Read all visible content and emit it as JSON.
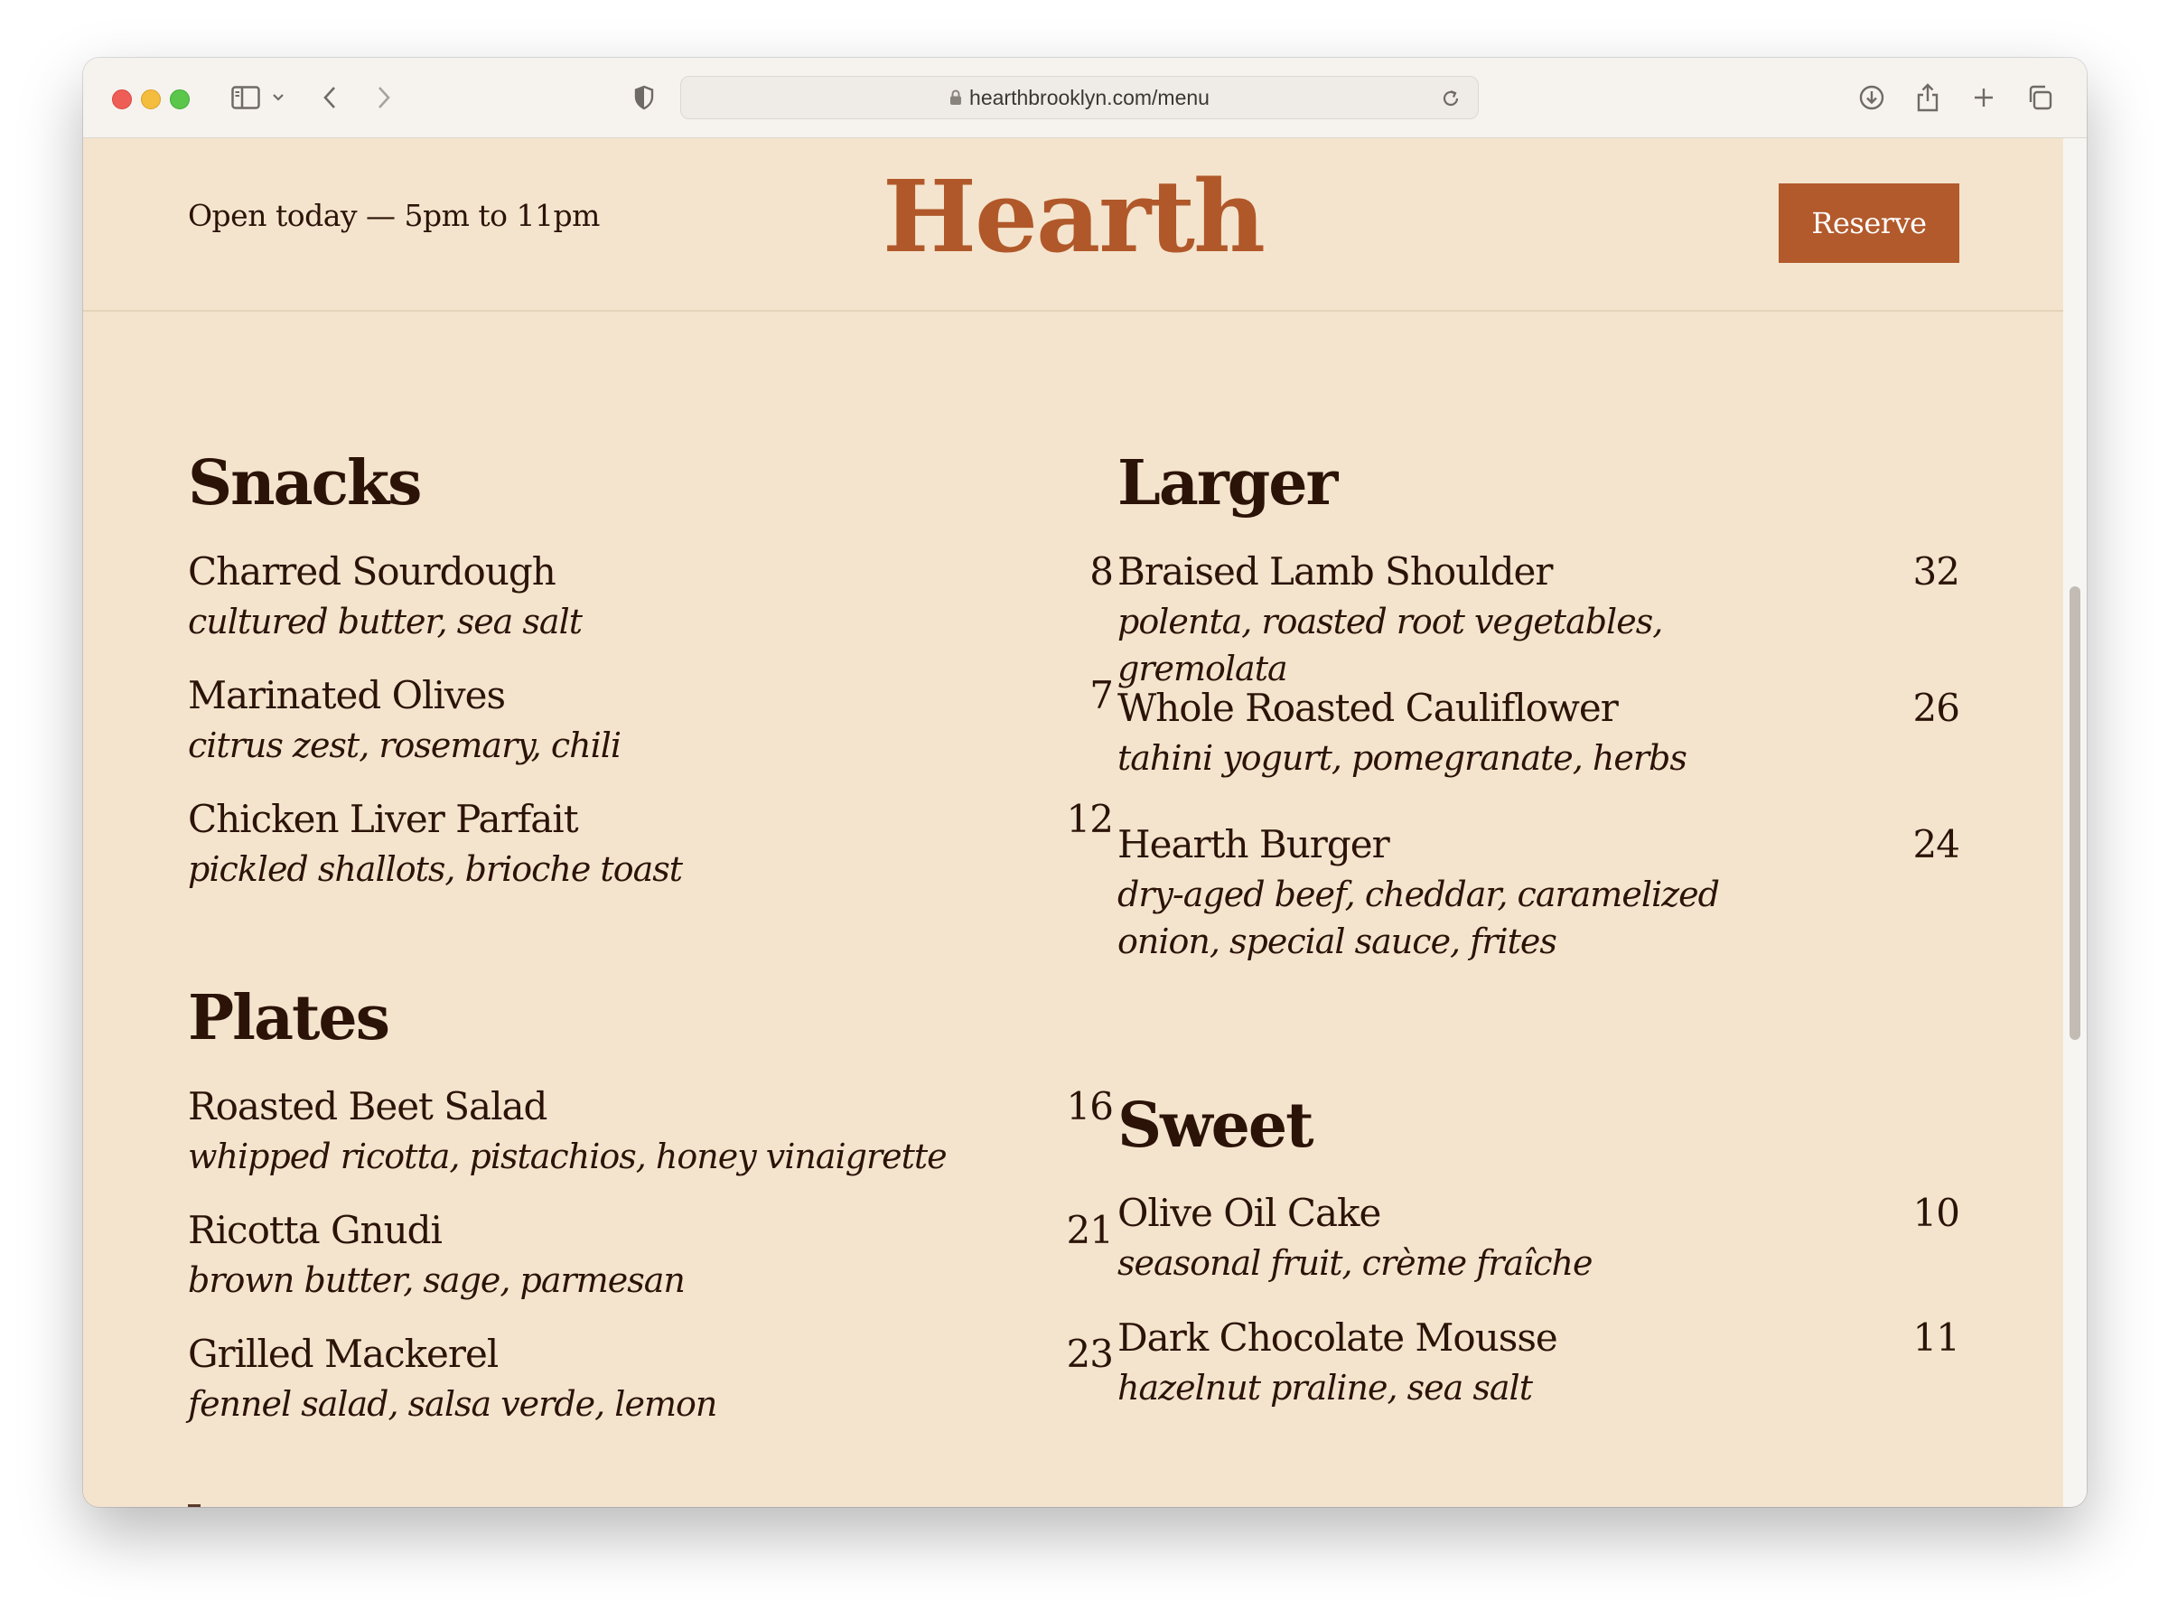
{
  "browser": {
    "url": "hearthbrooklyn.com/menu"
  },
  "header": {
    "hours": "Open today — 5pm to 11pm",
    "logo": "Hearth",
    "reserve_label": "Reserve"
  },
  "menu": {
    "snacks": {
      "title": "Snacks",
      "items": [
        {
          "name": "Charred Sourdough",
          "price": "8",
          "desc": "cultured butter, sea salt"
        },
        {
          "name": "Marinated Olives",
          "price": "7",
          "desc": "citrus zest, rosemary, chili"
        },
        {
          "name": "Chicken Liver Parfait",
          "price": "12",
          "desc": "pickled shallots, brioche toast"
        }
      ]
    },
    "plates": {
      "title": "Plates",
      "items": [
        {
          "name": "Roasted Beet Salad",
          "price": "16",
          "desc": "whipped ricotta, pistachios, honey vinaigrette"
        },
        {
          "name": "Ricotta Gnudi",
          "price": "21",
          "desc": "brown butter, sage, parmesan"
        },
        {
          "name": "Grilled Mackerel",
          "price": "23",
          "desc": "fennel salad, salsa verde, lemon"
        }
      ]
    },
    "larger": {
      "title": "Larger",
      "items": [
        {
          "name": "Braised Lamb Shoulder",
          "price": "32",
          "desc": "polenta, roasted root vegetables, gremolata"
        },
        {
          "name": "Whole Roasted Cauliflower",
          "price": "26",
          "desc": "tahini yogurt, pomegranate, herbs"
        },
        {
          "name": "Hearth Burger",
          "price": "24",
          "desc": "dry-aged beef, cheddar, caramelized onion, special sauce, frites"
        }
      ]
    },
    "sweet": {
      "title": "Sweet",
      "items": [
        {
          "name": "Olive Oil Cake",
          "price": "10",
          "desc": "seasonal fruit, crème fraîche"
        },
        {
          "name": "Dark Chocolate Mousse",
          "price": "11",
          "desc": "hazelnut praline, sea salt"
        }
      ]
    }
  },
  "colors": {
    "page_background": "#f5e4cd",
    "brand_accent": "#b0582a",
    "button_background": "#b25a2c",
    "text": "#2b1308"
  }
}
